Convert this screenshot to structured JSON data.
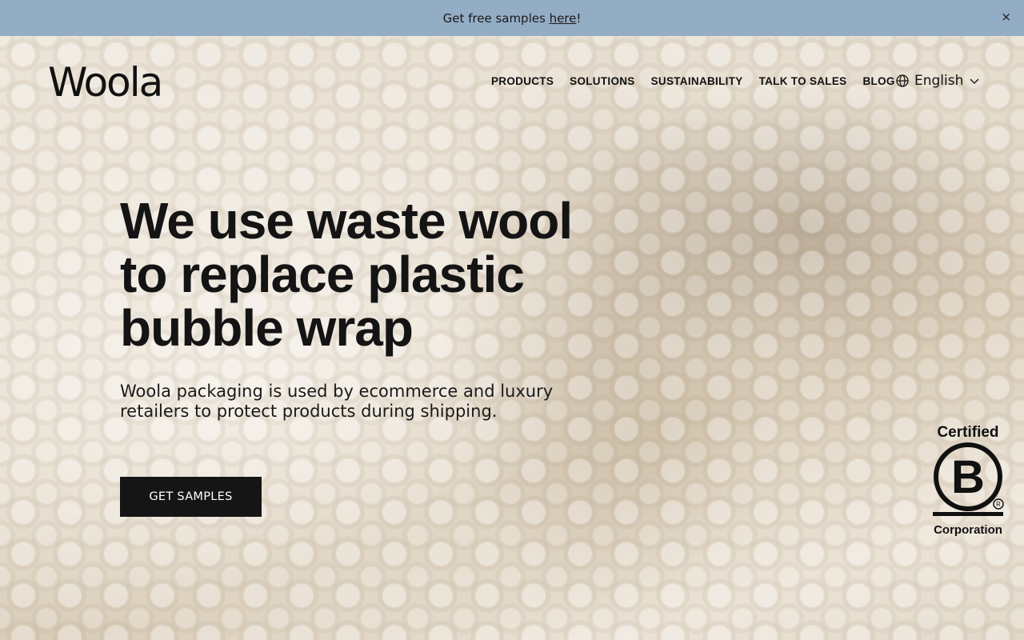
{
  "announcement": {
    "prefix": "Get free samples ",
    "link": "here",
    "suffix": "!",
    "close": "×"
  },
  "header": {
    "logo": "Woola",
    "nav": [
      "PRODUCTS",
      "SOLUTIONS",
      "SUSTAINABILITY",
      "TALK TO SALES",
      "BLOG"
    ],
    "language": "English"
  },
  "hero": {
    "headline_lines": [
      "We use waste wool",
      "to replace plastic",
      "bubble wrap"
    ],
    "subhead_lines": [
      "Woola packaging is used by ecommerce and luxury",
      "retailers to protect products during shipping."
    ],
    "cta": "GET SAMPLES"
  },
  "badge": {
    "top": "Certified",
    "letter": "B",
    "bottom": "Corporation"
  },
  "colors": {
    "announce_bg": "#93adc4",
    "cta_bg": "#151515",
    "text": "#111111"
  }
}
